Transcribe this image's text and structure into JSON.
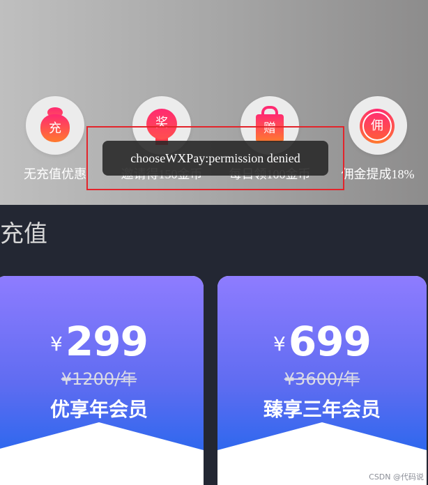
{
  "header": {
    "icons": [
      {
        "glyph": "充",
        "label": "无充值优惠"
      },
      {
        "glyph": "奖",
        "label": "邀请得150金币"
      },
      {
        "glyph": "赠",
        "label": "每日领100金币"
      },
      {
        "glyph": "佣",
        "label": "佣金提成18%"
      }
    ]
  },
  "toast": {
    "text": "chooseWXPay:permission denied"
  },
  "section": {
    "title": "充值"
  },
  "plans": [
    {
      "currency": "¥",
      "price": "299",
      "old_price": "¥1200/年",
      "name": "优享年会员"
    },
    {
      "currency": "¥",
      "price": "699",
      "old_price": "¥3600/年",
      "name": "臻享三年会员"
    }
  ],
  "footer": {
    "watermark": "CSDN @代码说"
  },
  "colors": {
    "accent_pink": "#ff2a71",
    "card_top": "#8e7cff",
    "card_bottom": "#2f68ee",
    "highlight": "#e3242b"
  }
}
